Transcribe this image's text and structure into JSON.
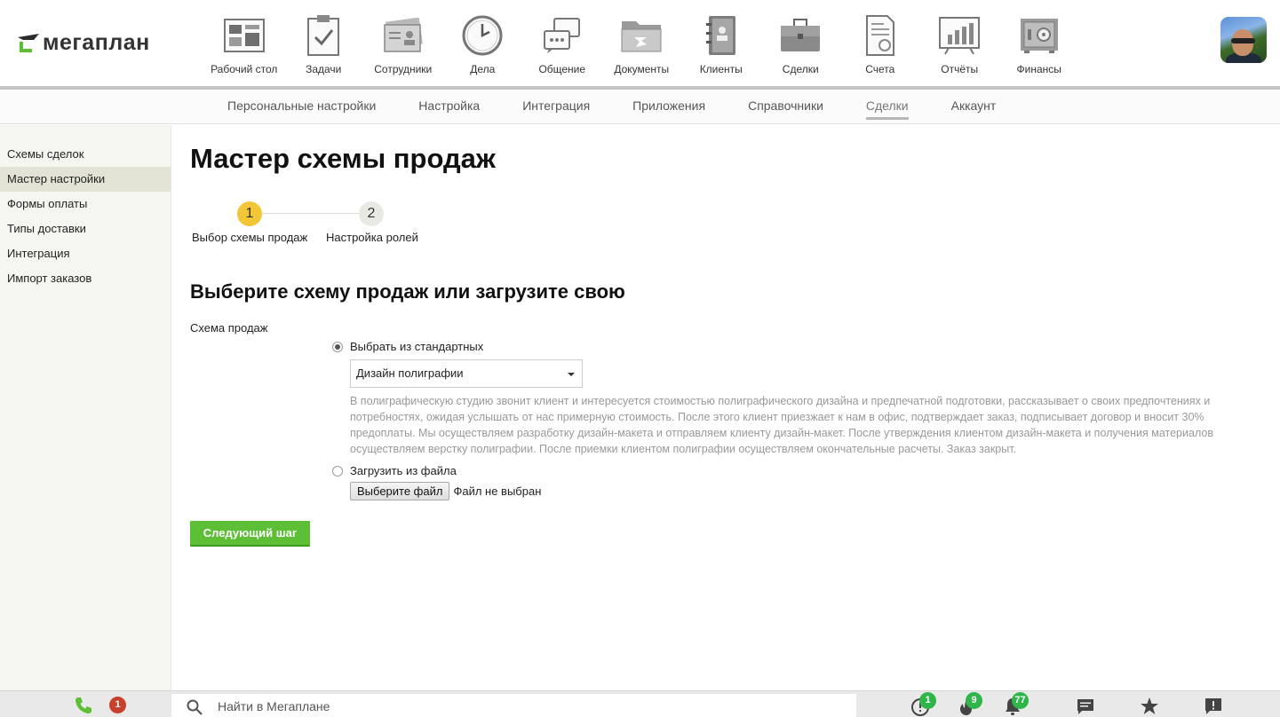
{
  "app": {
    "logo_text": "мегаплан"
  },
  "nav": {
    "items": [
      {
        "label": "Рабочий стол",
        "icon": "desktop-icon"
      },
      {
        "label": "Задачи",
        "icon": "tasks-icon"
      },
      {
        "label": "Сотрудники",
        "icon": "employees-icon"
      },
      {
        "label": "Дела",
        "icon": "clock-icon"
      },
      {
        "label": "Общение",
        "icon": "chat-icon"
      },
      {
        "label": "Документы",
        "icon": "folder-icon"
      },
      {
        "label": "Клиенты",
        "icon": "contacts-book-icon"
      },
      {
        "label": "Сделки",
        "icon": "briefcase-icon"
      },
      {
        "label": "Счета",
        "icon": "invoice-icon"
      },
      {
        "label": "Отчёты",
        "icon": "chart-board-icon"
      },
      {
        "label": "Финансы",
        "icon": "safe-icon"
      }
    ]
  },
  "subnav": {
    "items": [
      {
        "label": "Персональные настройки",
        "active": false
      },
      {
        "label": "Настройка",
        "active": false
      },
      {
        "label": "Интеграция",
        "active": false
      },
      {
        "label": "Приложения",
        "active": false
      },
      {
        "label": "Справочники",
        "active": false
      },
      {
        "label": "Сделки",
        "active": true
      },
      {
        "label": "Аккаунт",
        "active": false
      }
    ]
  },
  "sidebar": {
    "items": [
      {
        "label": "Схемы сделок",
        "active": false
      },
      {
        "label": "Мастер настройки",
        "active": true
      },
      {
        "label": "Формы оплаты",
        "active": false
      },
      {
        "label": "Типы доставки",
        "active": false
      },
      {
        "label": "Интеграция",
        "active": false
      },
      {
        "label": "Импорт заказов",
        "active": false
      }
    ]
  },
  "main": {
    "title": "Мастер схемы продаж",
    "steps": [
      {
        "number": "1",
        "label": "Выбор схемы продаж",
        "active": true
      },
      {
        "number": "2",
        "label": "Настройка ролей",
        "active": false
      }
    ],
    "section_title": "Выберите схему продаж или загрузите свою",
    "field_label": "Схема продаж",
    "option_standard": "Выбрать из стандартных",
    "selected_scheme": "Дизайн полиграфии",
    "description": "В полиграфическую студию звонит клиент и интересуется стоимостью полиграфического дизайна и предпечатной подготовки, рассказывает о своих предпочтениях и потребностях, ожидая услышать от нас примерную стоимость. После этого клиент приезжает к нам в офис, подтверждает заказ, подписывает договор и вносит 30% предоплаты. Мы осуществляем разработку дизайн-макета и отправляем клиенту дизайн-макет. После утверждения клиентом дизайн-макета и получения материалов осуществляем верстку полиграфии. После приемки клиентом полиграфии осуществляем окончательные расчеты. Заказ закрыт.",
    "option_upload": "Загрузить из файла",
    "file_button": "Выберите файл",
    "file_status": "Файл не выбран",
    "next_button": "Следующий шаг"
  },
  "bottombar": {
    "phone_badge": "1",
    "search_placeholder": "Найти в Мегаплане",
    "alerts_badge": "1",
    "hot_badge": "9",
    "notifications_badge": "77"
  },
  "colors": {
    "accent_green": "#5cbf36",
    "step_active": "#f2c636",
    "badge_red": "#c8402c",
    "badge_green": "#2fb54a"
  }
}
